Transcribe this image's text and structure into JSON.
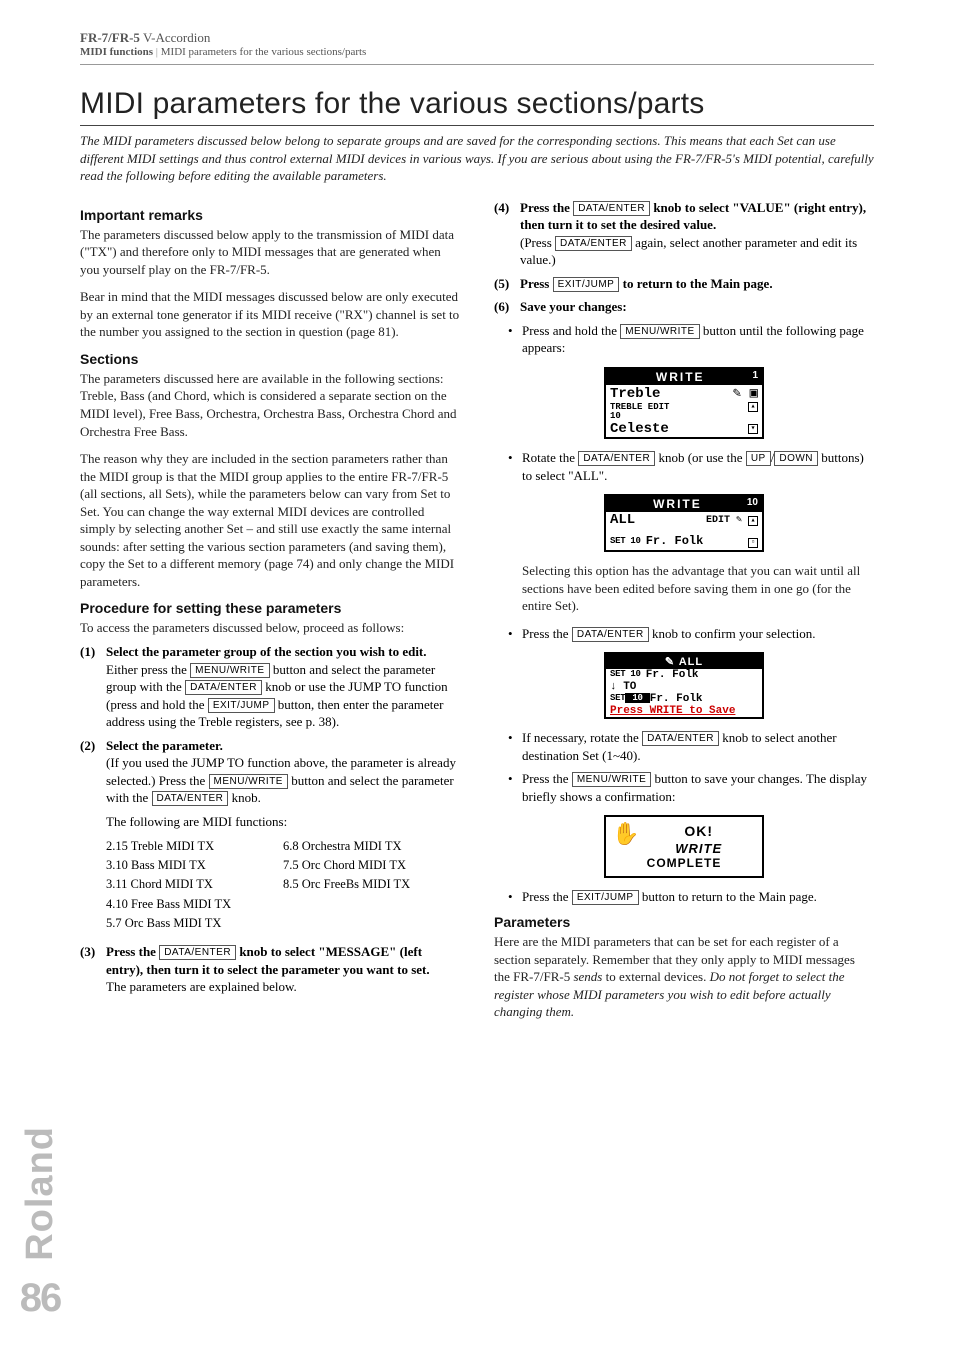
{
  "header": {
    "product_bold": "FR-7/FR-5",
    "product_thin": " V-Accordion",
    "crumb_section": "MIDI functions",
    "crumb_sep": " | ",
    "crumb_page": "MIDI parameters for the various sections/parts"
  },
  "title": "MIDI parameters for the various sections/parts",
  "intro": "The MIDI parameters discussed below belong to separate groups and are saved for the corresponding sections. This means that each Set can use different MIDI settings and thus control external MIDI devices in various ways. If you are serious about using the FR-7/FR-5's MIDI potential, carefully read the following before editing the available parameters.",
  "left": {
    "h_important": "Important remarks",
    "p_important1": "The parameters discussed below apply to the transmission of MIDI data (\"TX\") and therefore only to MIDI messages that are generated when you yourself play on the FR-7/FR-5.",
    "p_important2": "Bear in mind that the MIDI messages discussed below are only executed by an external tone generator if its MIDI receive (\"RX\") channel is set to the number you assigned to the section in question (page 81).",
    "h_sections": "Sections",
    "p_sections1": "The parameters discussed here are available in the following sections: Treble, Bass (and Chord, which is considered a separate section on the MIDI level), Free Bass, Orchestra, Orchestra Bass, Orchestra Chord and Orchestra Free Bass.",
    "p_sections2": "The reason why they are included in the section parameters rather than the MIDI group is that the MIDI group applies to the entire FR-7/FR-5 (all sections, all Sets), while the parameters below can vary from Set to Set. You can change the way external MIDI devices are controlled simply by selecting another Set – and still use exactly the same internal sounds: after setting the various section parameters (and saving them), copy the Set to a different memory (page 74) and only change the MIDI parameters.",
    "h_proc": "Procedure for setting these parameters",
    "p_proc": "To access the parameters discussed below, proceed as follows:",
    "step1_num": "(1)",
    "step1_bold": "Select the parameter group of the section you wish to edit.",
    "step1_a": "Either press the ",
    "step1_key1": "MENU/WRITE",
    "step1_b": " button and select the parameter group with the ",
    "step1_key2": "DATA/ENTER",
    "step1_c": " knob or use the JUMP TO function (press and hold the ",
    "step1_key3": "EXIT/JUMP",
    "step1_d": " button, then enter the parameter address using the Treble registers, see p. 38).",
    "step2_num": "(2)",
    "step2_bold": "Select the parameter.",
    "step2_a": "(If you used the JUMP TO function above, the parameter is already selected.) Press the ",
    "step2_key1": "MENU/WRITE",
    "step2_b": " button and select the parameter with the ",
    "step2_key2": "DATA/ENTER",
    "step2_c": " knob.",
    "step2_follow": "The following are MIDI functions:",
    "midi_left": [
      "2.15 Treble MIDI TX",
      "3.10 Bass MIDI TX",
      "3.11 Chord MIDI TX",
      "4.10 Free Bass MIDI TX",
      "5.7 Orc Bass MIDI TX"
    ],
    "midi_right": [
      "6.8 Orchestra MIDI TX",
      "7.5 Orc Chord MIDI TX",
      "8.5 Orc FreeBs MIDI TX"
    ],
    "step3_num": "(3)",
    "step3_a": "Press the ",
    "step3_key1": "DATA/ENTER",
    "step3_b": " knob to select \"MESSAGE\" (left entry), then turn it to select the parameter you want to set.",
    "step3_plain": "The parameters are explained below."
  },
  "right": {
    "step4_num": "(4)",
    "step4_a": "Press the ",
    "step4_key1": "DATA/ENTER",
    "step4_b": " knob to select \"VALUE\" (right entry), then turn it to set the desired value.",
    "step4_plain_a": "(Press ",
    "step4_key2": "DATA/ENTER",
    "step4_plain_b": " again, select another parameter and edit its value.)",
    "step5_num": "(5)",
    "step5_a": "Press ",
    "step5_key1": "EXIT/JUMP",
    "step5_b": " to return to the Main page.",
    "step6_num": "(6)",
    "step6_bold": "Save your changes:",
    "b1_a": "Press and hold the ",
    "b1_key": "MENU/WRITE",
    "b1_b": " button until the following page appears:",
    "lcd1": {
      "title": "WRITE",
      "rn": "1",
      "r1": "Treble",
      "r2a": "TREBLE",
      "r2b": " EDIT",
      "r3": "10",
      "r4": "Celeste"
    },
    "b2_a": "Rotate the ",
    "b2_key1": "DATA/ENTER",
    "b2_b": " knob (or use the ",
    "b2_key2": "UP",
    "b2_c": "/",
    "b2_key3": "DOWN",
    "b2_d": " buttons) to select \"ALL\".",
    "lcd2": {
      "title": "WRITE",
      "rn": "10",
      "r1": "ALL",
      "r1b": "EDIT",
      "r2a": "SET",
      "r2b": " 10 ",
      "r2c": "Fr. Folk"
    },
    "p_after2": "Selecting this option has the advantage that you can wait until all sections have been edited before saving them in one go (for the entire Set).",
    "b3_a": "Press the ",
    "b3_key": "DATA/ENTER",
    "b3_b": " knob to confirm your selection.",
    "lcd3": {
      "bar": "✎    ALL",
      "r1a": "SET",
      "r1b": " 10 ",
      "r1c": "Fr. Folk",
      "r2": "↓ TO",
      "r3a": "SET",
      "r3b": " 10 ",
      "r3c": "Fr. Folk",
      "r4": "Press WRITE to Save"
    },
    "b4_a": "If necessary, rotate the ",
    "b4_key": "DATA/ENTER",
    "b4_b": " knob to select another destination Set (1~40).",
    "b5_a": "Press the ",
    "b5_key": "MENU/WRITE",
    "b5_b": " button to save your changes. The display briefly shows a confirmation:",
    "lcd4": {
      "ok": "OK!",
      "wr": "WRITE",
      "cp": "COMPLETE"
    },
    "b6_a": "Press the ",
    "b6_key": "EXIT/JUMP",
    "b6_b": " button to return to the Main page.",
    "h_params": "Parameters",
    "p_params_a": "Here are the MIDI parameters that can be set for each register of a section separately. Remember that they only apply to MIDI messages the FR-7/FR-5 ",
    "p_params_ital1": "sends",
    "p_params_b": " to external devices. ",
    "p_params_ital2": "Do not forget to select the register whose MIDI parameters you wish to edit before actually changing them."
  },
  "brand": {
    "name": "Roland",
    "page": "86"
  }
}
